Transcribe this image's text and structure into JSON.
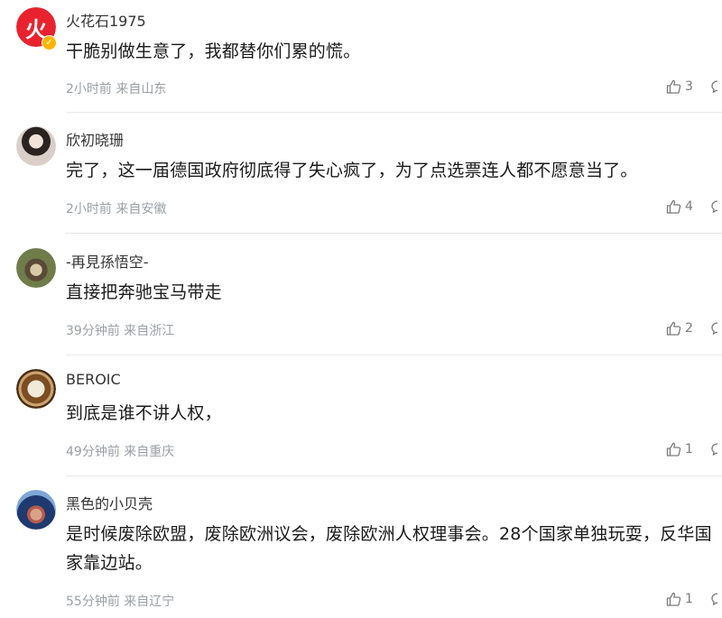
{
  "comments": [
    {
      "username": "火花石1975",
      "text": "干脆别做生意了，我都替你们累的慌。",
      "time": "2小时前",
      "location": "来自山东",
      "likes": "3",
      "avatar_glyph": "火",
      "avatar_color": "#e8232e",
      "verified": true
    },
    {
      "username": "欣初晓珊",
      "text": "完了，这一届德国政府彻底得了失心疯了，为了点选票连人都不愿意当了。",
      "time": "2小时前",
      "location": "来自安徽",
      "likes": "4"
    },
    {
      "username": "-再見孫悟空-",
      "text": "直接把奔驰宝马带走",
      "time": "39分钟前",
      "location": "来自浙江",
      "likes": "2"
    },
    {
      "username": "BEROIC",
      "text": "到底是谁不讲人权，",
      "time": "49分钟前",
      "location": "来自重庆",
      "likes": "1"
    },
    {
      "username": "黑色的小贝壳",
      "text": "是时候废除欧盟，废除欧洲议会，废除欧洲人权理事会。28个国家单独玩耍，反华国家靠边站。",
      "time": "55分钟前",
      "location": "来自辽宁",
      "likes": "1"
    }
  ],
  "icons": {
    "like": "thumbs-up-icon",
    "reply": "comment-icon",
    "verified": "verified-badge-icon"
  },
  "colors": {
    "text": "#1a1a1a",
    "username": "#333333",
    "meta": "#9aa0a6",
    "divider": "#e8e8e8",
    "verified": "#ffb400"
  }
}
